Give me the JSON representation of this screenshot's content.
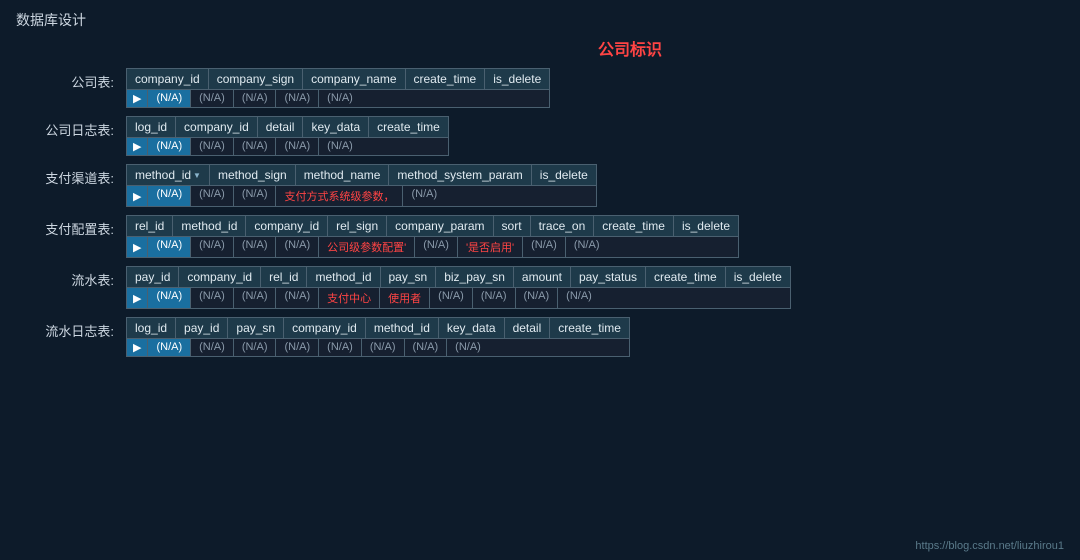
{
  "pageTitle": "数据库设计",
  "sectionHeader": "公司标识",
  "footerUrl": "https://blog.csdn.net/liuzhirou1",
  "tables": {
    "company": {
      "label": "公司表:",
      "headers": [
        "company_id",
        "company_sign",
        "company_name",
        "create_time",
        "is_delete"
      ],
      "row": [
        "(N/A)",
        "(N/A)",
        "(N/A)",
        "(N/A)",
        "(N/A)"
      ],
      "highlightFirst": true
    },
    "companyLog": {
      "label": "公司日志表:",
      "headers": [
        "log_id",
        "company_id",
        "detail",
        "key_data",
        "create_time"
      ],
      "row": [
        "(N/A)",
        "(N/A)",
        "(N/A)",
        "(N/A)",
        "(N/A)"
      ],
      "highlightFirst": true
    },
    "payMethod": {
      "label": "支付渠道表:",
      "headers": [
        "method_id",
        "method_sign",
        "method_name",
        "method_system_param",
        "is_delete"
      ],
      "row": [
        "(N/A)",
        "(N/A)",
        "(N/A)",
        "支付方式系统级参数，",
        "(N/A)"
      ],
      "highlightFirst": true,
      "redCell": 3
    },
    "payConfig": {
      "label": "支付配置表:",
      "headers": [
        "rel_id",
        "method_id",
        "company_id",
        "rel_sign",
        "company_param",
        "sort",
        "trace_on",
        "create_time",
        "is_delete"
      ],
      "row": [
        "(N/A)",
        "(N/A)",
        "(N/A)",
        "(N/A)",
        "公司级参数配置'",
        "(N/A)",
        "'是否启用'",
        "(N/A)",
        "(N/A)"
      ],
      "highlightFirst": true,
      "redCell": 4
    },
    "flow": {
      "label": "流水表:",
      "headers": [
        "pay_id",
        "company_id",
        "rel_id",
        "method_id",
        "pay_sn",
        "biz_pay_sn",
        "amount",
        "pay_status",
        "create_time",
        "is_delete"
      ],
      "row": [
        "(N/A)",
        "(N/A)",
        "(N/A)",
        "(N/A)",
        "支付中心",
        "使用者",
        "(N/A)",
        "(N/A)",
        "(N/A)",
        "(N/A)"
      ],
      "highlightFirst": true,
      "redCells": [
        4,
        5
      ]
    },
    "flowLog": {
      "label": "流水日志表:",
      "headers": [
        "log_id",
        "pay_id",
        "pay_sn",
        "company_id",
        "method_id",
        "key_data",
        "detail",
        "create_time"
      ],
      "row": [
        "(N/A)",
        "(N/A)",
        "(N/A)",
        "(N/A)",
        "(N/A)",
        "(N/A)",
        "(N/A)",
        "(N/A)"
      ],
      "highlightFirst": true
    }
  }
}
